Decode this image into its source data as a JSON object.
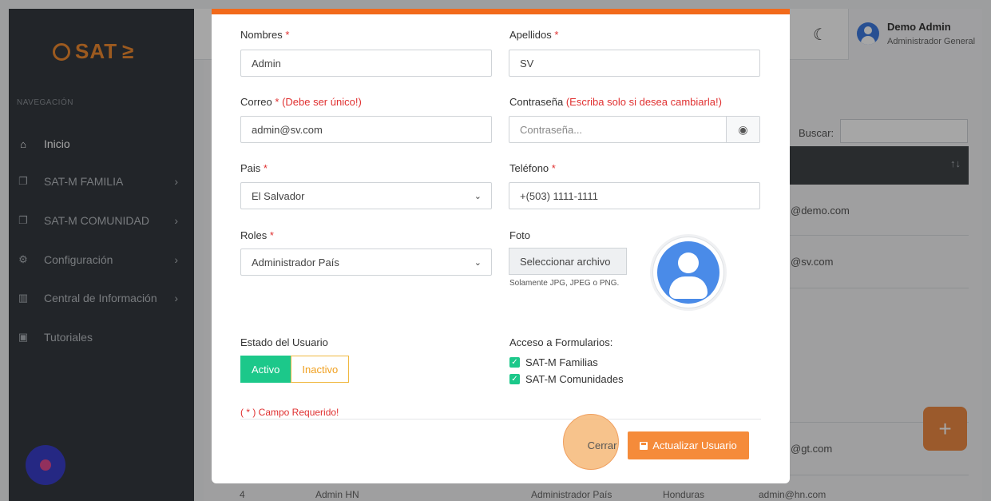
{
  "app": {
    "logo_text": "SAT",
    "logo_suffix": "≥"
  },
  "sidebar": {
    "section_title": "NAVEGACIÓN",
    "items": [
      {
        "label": "Inicio",
        "icon": "home-icon",
        "active": true
      },
      {
        "label": "SAT-M FAMILIA",
        "icon": "copy-icon",
        "has_chevron": true
      },
      {
        "label": "SAT-M COMUNIDAD",
        "icon": "copy-icon",
        "has_chevron": true
      },
      {
        "label": "Configuración",
        "icon": "gear-icon",
        "has_chevron": true
      },
      {
        "label": "Central de Información",
        "icon": "bar-chart-icon",
        "has_chevron": true
      },
      {
        "label": "Tutoriales",
        "icon": "presentation-icon",
        "has_chevron": false
      }
    ]
  },
  "topbar": {
    "user_name": "Demo Admin",
    "user_role": "Administrador General"
  },
  "background_table": {
    "search_label": "Buscar:",
    "emails": [
      "@demo.com",
      "@sv.com",
      "@gt.com"
    ],
    "bottom_row": {
      "index": "4",
      "name": "Admin HN",
      "role": "Administrador País",
      "country": "Honduras",
      "email": "admin@hn.com"
    }
  },
  "form": {
    "nombres": {
      "label": "Nombres",
      "value": "Admin"
    },
    "apellidos": {
      "label": "Apellidos",
      "value": "SV"
    },
    "correo": {
      "label": "Correo",
      "note": "(Debe ser único!)",
      "value": "admin@sv.com"
    },
    "contrasena": {
      "label": "Contraseña",
      "note": "(Escriba solo si desea cambiarla!)",
      "placeholder": "Contraseña..."
    },
    "pais": {
      "label": "Pais",
      "value": "El Salvador"
    },
    "telefono": {
      "label": "Teléfono",
      "value": "+(503) 1111-1111"
    },
    "roles": {
      "label": "Roles",
      "value": "Administrador País"
    },
    "foto": {
      "label": "Foto",
      "button": "Seleccionar archivo",
      "help": "Solamente JPG, JPEG o PNG."
    },
    "estado": {
      "label": "Estado del Usuario",
      "on_label": "Activo",
      "off_label": "Inactivo",
      "selected": "Activo"
    },
    "acceso": {
      "label": "Acceso a Formularios:",
      "options": [
        {
          "label": "SAT-M Familias",
          "checked": true
        },
        {
          "label": "SAT-M Comunidades",
          "checked": true
        }
      ]
    },
    "required_note": "( * ) Campo Requerido!",
    "required_mark": "*",
    "close_button": "Cerrar",
    "submit_button": "Actualizar Usuario"
  },
  "colors": {
    "accent": "#f26a1b",
    "button": "#f58b3a",
    "success": "#1cc88a",
    "sidebar": "#353a40"
  }
}
